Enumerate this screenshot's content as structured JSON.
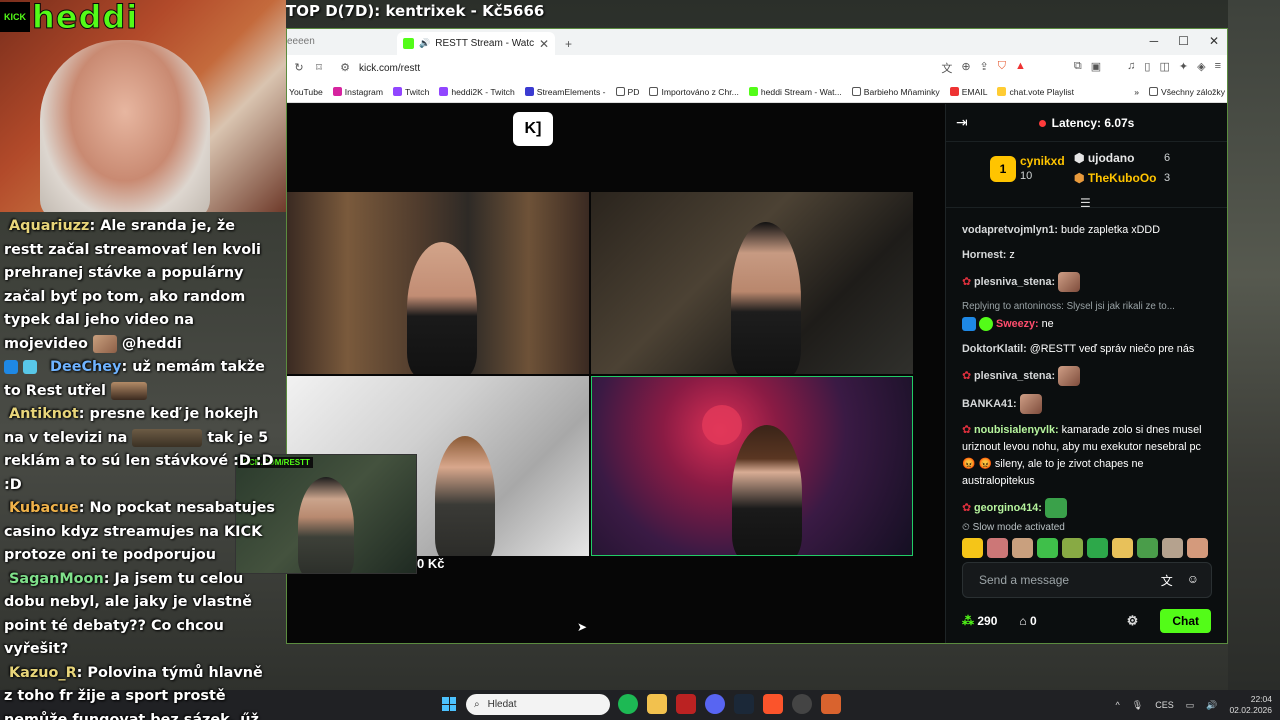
{
  "overlay": {
    "streamer_name": "heddi",
    "kick_label": "KICK",
    "top_banner": "TOP D(7D): kentrixek - Kč5666",
    "chat": [
      {
        "user": "Aquariuzz",
        "text": ": Ale sranda je, že restt začal streamovať len kvoli prehranej stávke a populárny začal byť po tom, ako random typek dal jeho video na mojevideo",
        "tail": "@heddi",
        "color": "yellow"
      },
      {
        "user": "DeeChey",
        "text": ": už nemám takže to Rest utřel",
        "color": "blue"
      },
      {
        "user": "Antiknot",
        "text": ": presne keď je hokejh na v televizi na",
        "tail": "tak je 5 reklám a to sú len stávkové :D :D :D",
        "color": "yellow"
      },
      {
        "user": "Kubacue",
        "text": ": No pockat nesabatujes casino kdyz streamujes na KICK protoze oni te podporujou",
        "color": "orange"
      },
      {
        "user": "SaganMoon",
        "text": ": Ja jsem tu celou dobu nebyl, ale jaky je vlastně point té debaty?? Co chcou vyřešit?",
        "color": "yellow"
      },
      {
        "user": "Kazuo_R",
        "text": ": Polovina týmů hlavně z toho fr žije a sport prostě nemůže fungovat bez sázek, űž se to zkoušelo a nejde to",
        "color": "yellow"
      }
    ]
  },
  "browser": {
    "prev_tab_label": "eeeen",
    "tab_title": "RESTT Stream - Watch Live on",
    "url": "kick.com/restt",
    "bookmarks": [
      "YouTube",
      "Instagram",
      "Twitch",
      "heddi2K - Twitch",
      "StreamElements -",
      "PD",
      "Importováno z Chr...",
      "heddi Stream - Wat...",
      "Barbieho Mňaminky",
      "EMAIL",
      "chat.vote Playlist"
    ],
    "bookmarks_more": "»",
    "bookmarks_all": "Všechny záložky"
  },
  "stream": {
    "pip_tag": "KICK.COM/RESTT",
    "donation_amount": "0 Kč"
  },
  "chat": {
    "latency": "Latency: 6.07s",
    "leaderboard": {
      "first": {
        "rank": "1",
        "name": "cynikxd",
        "count": "10"
      },
      "second": {
        "name": "ujodano",
        "count": "6"
      },
      "third": {
        "name": "TheKuboOo",
        "count": "3"
      }
    },
    "messages": [
      {
        "user": "vodapretvojmlyn1:",
        "text": " bude zapletka xDDD",
        "color": "#d7d9da"
      },
      {
        "user": "Hornest:",
        "text": " z",
        "color": "#d7d9da"
      },
      {
        "user": "plesniva_stena:",
        "text": "",
        "color": "#d7d9da",
        "emote": true,
        "rose": true
      },
      {
        "reply": "Replying to antoninoss: Slysel jsi jak rikali ze to...",
        "user": "Sweezy:",
        "text": " ne",
        "color": "#ff4d6d",
        "badges": true
      },
      {
        "user": "DoktorKlatil:",
        "text": " @RESTT veď správ niečo pre nás",
        "color": "#d7d9da"
      },
      {
        "user": "plesniva_stena:",
        "text": "",
        "color": "#d7d9da",
        "emote": true,
        "rose": true
      },
      {
        "user": "BANKA41:",
        "text": "",
        "color": "#d7d9da",
        "emote": true
      },
      {
        "user": "noubisialenyvlk:",
        "text": " kamarade zolo si dnes musel uriznout levou nohu, aby mu exekutor nesebral pc 😡 😡 sileny, ale to je zivot chapes ne australopitekus",
        "color": "#b7f59e",
        "rose": true
      },
      {
        "user": "georgino414:",
        "text": "",
        "color": "#b7f59e",
        "emote": true,
        "rose": true
      }
    ],
    "slow_mode": "Slow mode activated",
    "input_placeholder": "Send a message",
    "points": "290",
    "drops": "0",
    "chat_button": "Chat"
  },
  "taskbar": {
    "search_placeholder": "Hledat",
    "lang": "CES",
    "time": "22:04",
    "date": "02.02.2026"
  }
}
